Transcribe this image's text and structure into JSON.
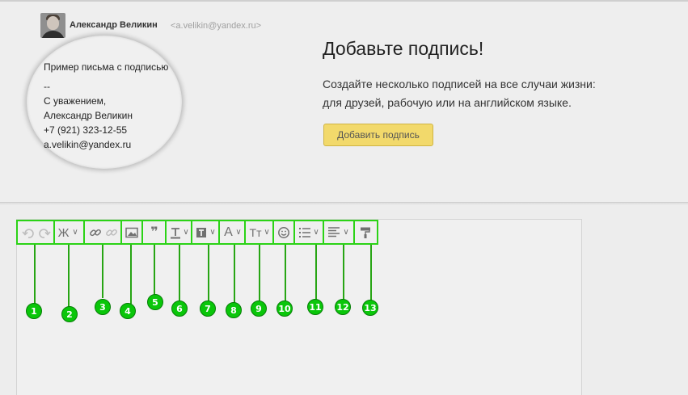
{
  "colors": {
    "accent_green": "#2bd316",
    "badge_green": "#0ac60a",
    "button_yellow": "#f3d54f"
  },
  "preview": {
    "sender_name": "Александр Великин",
    "sender_email": "<a.velikin@yandex.ru>",
    "sample_subject": "Пример письма с подписью",
    "signature_lines": [
      "--",
      "С уважением,",
      "Александр Великин",
      "+7 (921) 323-12-55",
      "a.velikin@yandex.ru"
    ]
  },
  "promo": {
    "title": "Добавьте подпись!",
    "text_line1": "Создайте несколько подписей на все случаи жизни:",
    "text_line2": "для друзей, рабочую или на английском языке.",
    "button_label": "Добавить подпись"
  },
  "toolbar": {
    "bold_glyph": "Ж",
    "quote_glyph": "❞",
    "font_color_glyph": "A",
    "font_size_glyph": "Тт",
    "chevron": "∨",
    "icons": [
      "undo-icon",
      "redo-icon",
      "bold-icon",
      "link-icon",
      "unlink-icon",
      "image-icon",
      "quote-icon",
      "text-color-icon",
      "background-color-icon",
      "font-icon",
      "font-size-icon",
      "emoji-icon",
      "list-icon",
      "align-icon",
      "format-painter-icon"
    ]
  },
  "callouts": [
    "1",
    "2",
    "3",
    "4",
    "5",
    "6",
    "7",
    "8",
    "9",
    "10",
    "11",
    "12",
    "13"
  ]
}
